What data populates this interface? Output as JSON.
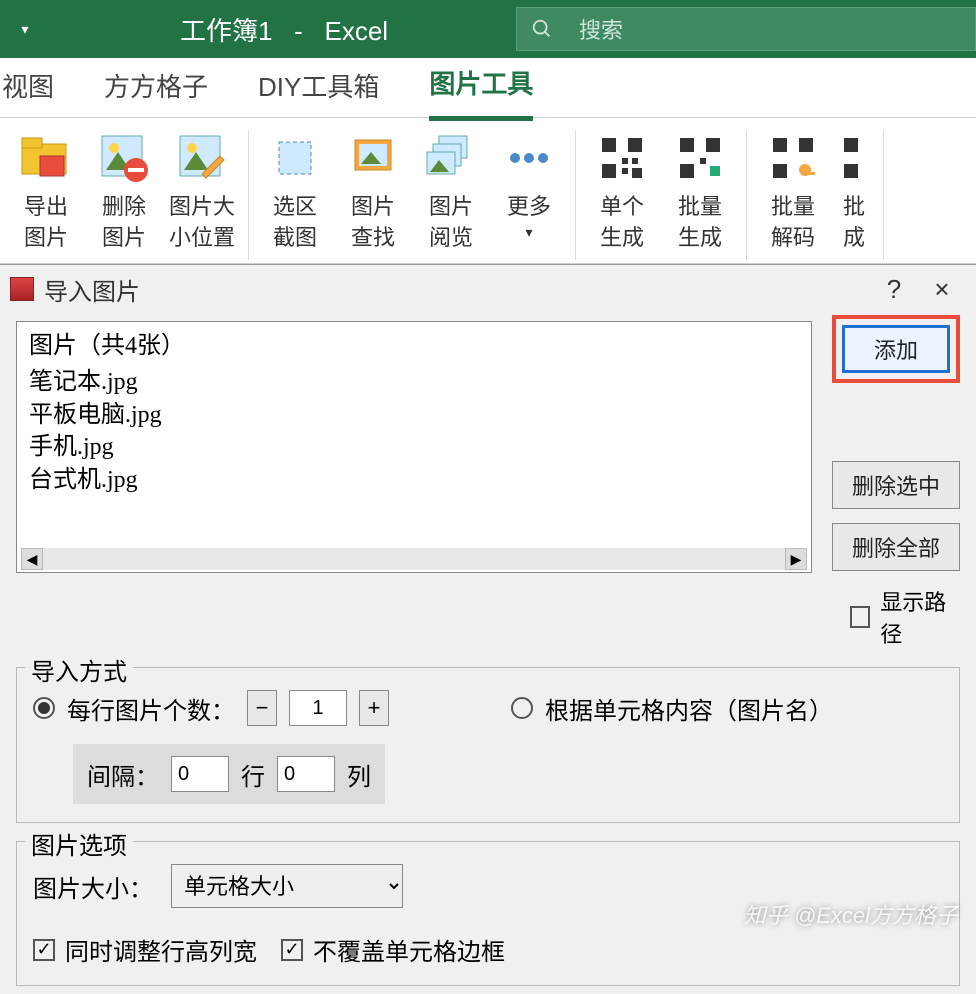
{
  "titlebar": {
    "workbook": "工作簿1",
    "sep": "-",
    "app": "Excel",
    "search_placeholder": "搜索"
  },
  "tabs": {
    "view": "视图",
    "fangfang": "方方格子",
    "diy": "DIY工具箱",
    "pic": "图片工具"
  },
  "ribbon": {
    "export_pic_l1": "导出",
    "export_pic_l2": "图片",
    "del_pic_l1": "删除",
    "del_pic_l2": "图片",
    "size_l1": "图片大",
    "size_l2": "小位置",
    "crop_l1": "选区",
    "crop_l2": "截图",
    "find_l1": "图片",
    "find_l2": "查找",
    "browse_l1": "图片",
    "browse_l2": "阅览",
    "more_l1": "更多",
    "more_l2": "",
    "qr1_l1": "单个",
    "qr1_l2": "生成",
    "qr2_l1": "批量",
    "qr2_l2": "生成",
    "qr3_l1": "批量",
    "qr3_l2": "解码",
    "qr4_l1": "批",
    "qr4_l2": "成"
  },
  "dialog": {
    "title": "导入图片",
    "help": "?",
    "close": "×",
    "file_header": "图片（共4张）",
    "files": [
      "笔记本.jpg",
      "平板电脑.jpg",
      "手机.jpg",
      "台式机.jpg"
    ],
    "add_btn": "添加",
    "del_selected_btn": "删除选中",
    "del_all_btn": "删除全部",
    "show_path": "显示路径",
    "import_mode": {
      "legend": "导入方式",
      "per_row": "每行图片个数：",
      "per_row_value": "1",
      "by_cell": "根据单元格内容（图片名）",
      "gap_label": "间隔：",
      "gap_row_value": "0",
      "gap_row_unit": "行",
      "gap_col_value": "0",
      "gap_col_unit": "列"
    },
    "pic_options": {
      "legend": "图片选项",
      "size_label": "图片大小：",
      "size_value": "单元格大小",
      "cb1": "同时调整行高列宽",
      "cb2": "不覆盖单元格边框"
    }
  },
  "watermark": "知乎 @Excel方方格子"
}
